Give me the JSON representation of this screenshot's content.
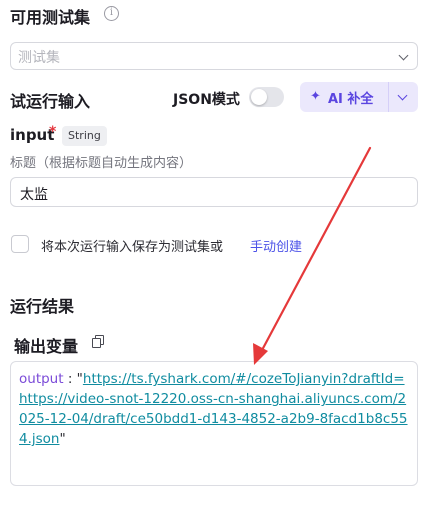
{
  "test_set": {
    "title": "可用测试集",
    "select_placeholder": "测试集"
  },
  "trial": {
    "title": "试运行输入",
    "json_mode_label": "JSON模式",
    "json_mode_on": false,
    "ai_button_label": "AI 补全"
  },
  "input": {
    "name": "input",
    "required_mark": "*",
    "type": "String",
    "description": "标题（根据标题自动生成内容）",
    "value": "太监"
  },
  "save_option": {
    "label": "将本次运行输入保存为测试集或",
    "link": "手动创建",
    "checked": false
  },
  "result": {
    "title": "运行结果",
    "output_label": "输出变量",
    "output_key": "output",
    "output_colon": " : ",
    "output_url": "https://ts.fyshark.com/#/cozeToJianyin?draftId=https://video-snot-12220.oss-cn-shanghai.aliyuncs.com/2025-12-04/draft/ce50bdd1-d143-4852-a2b9-8facd1b8c554.json"
  },
  "colors": {
    "accent": "#5a45e0",
    "link": "#4d53e8",
    "url": "#108ca0",
    "required": "#e5363e",
    "annotation_arrow": "#e5393a"
  },
  "icons": {
    "info": "info-circle-icon",
    "chevron": "chevron-down-icon",
    "ai": "sparkle-icon",
    "copy": "copy-icon"
  }
}
